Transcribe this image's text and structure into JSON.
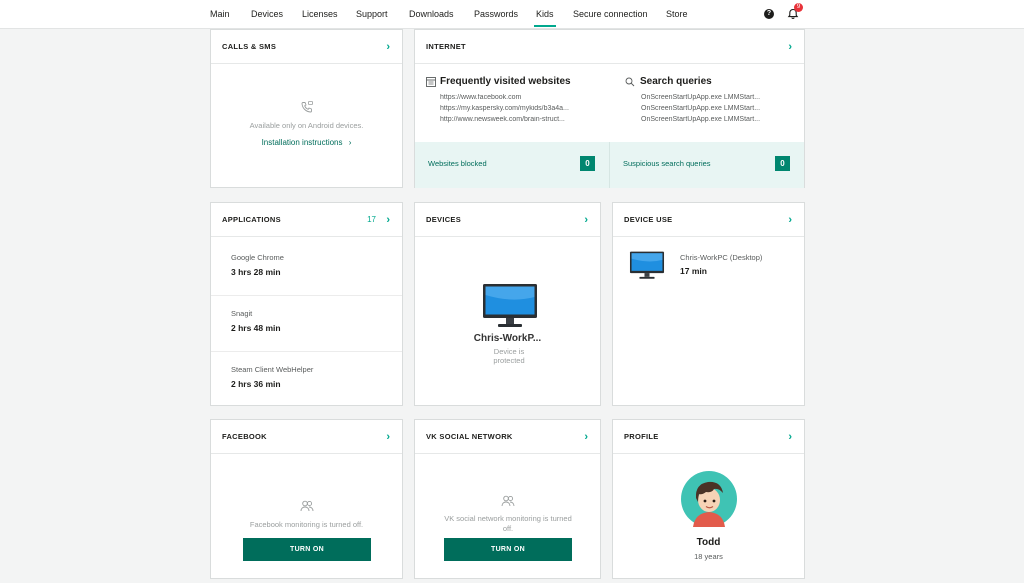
{
  "nav": {
    "items": [
      "Main",
      "Devices",
      "Licenses",
      "Support",
      "Downloads",
      "Passwords",
      "Kids",
      "Secure connection",
      "Store"
    ],
    "active": "Kids",
    "help_icon": "help-icon",
    "notifications_count": "9"
  },
  "calls": {
    "title": "CALLS & SMS",
    "message": "Available only on Android devices.",
    "link": "Installation instructions",
    "link_chevron": "›"
  },
  "internet": {
    "title": "INTERNET",
    "frequent_title": "Frequently visited websites",
    "sites": [
      "https://www.facebook.com",
      "https://my.kaspersky.com/mykids/b3a4a...",
      "http://www.newsweek.com/brain-struct..."
    ],
    "queries_title": "Search queries",
    "queries": [
      "OnScreenStartUpApp.exe LMMStart...",
      "OnScreenStartUpApp.exe LMMStart...",
      "OnScreenStartUpApp.exe LMMStart..."
    ],
    "blocked_label": "Websites blocked",
    "blocked_count": "0",
    "suspicious_label": "Suspicious search queries",
    "suspicious_count": "0"
  },
  "applications": {
    "title": "APPLICATIONS",
    "count": "17",
    "apps": [
      {
        "name": "Google Chrome",
        "time": "3 hrs 28 min"
      },
      {
        "name": "Snagit",
        "time": "2 hrs 48 min"
      },
      {
        "name": "Steam Client WebHelper",
        "time": "2 hrs 36 min"
      }
    ]
  },
  "devices": {
    "title": "DEVICES",
    "device_name": "Chris-WorkP...",
    "status": "Device is protected"
  },
  "device_use": {
    "title": "DEVICE USE",
    "device_name": "Chris-WorkPC (Desktop)",
    "time": "17 min"
  },
  "facebook": {
    "title": "FACEBOOK",
    "message": "Facebook monitoring is turned off.",
    "button": "TURN ON"
  },
  "vk": {
    "title": "VK SOCIAL NETWORK",
    "message": "VK social network monitoring is turned off.",
    "button": "TURN ON"
  },
  "profile": {
    "title": "PROFILE",
    "name": "Todd",
    "age": "18 years"
  },
  "colors": {
    "accent": "#00a88e",
    "button": "#006d5b",
    "badge_red": "#e8333a"
  }
}
